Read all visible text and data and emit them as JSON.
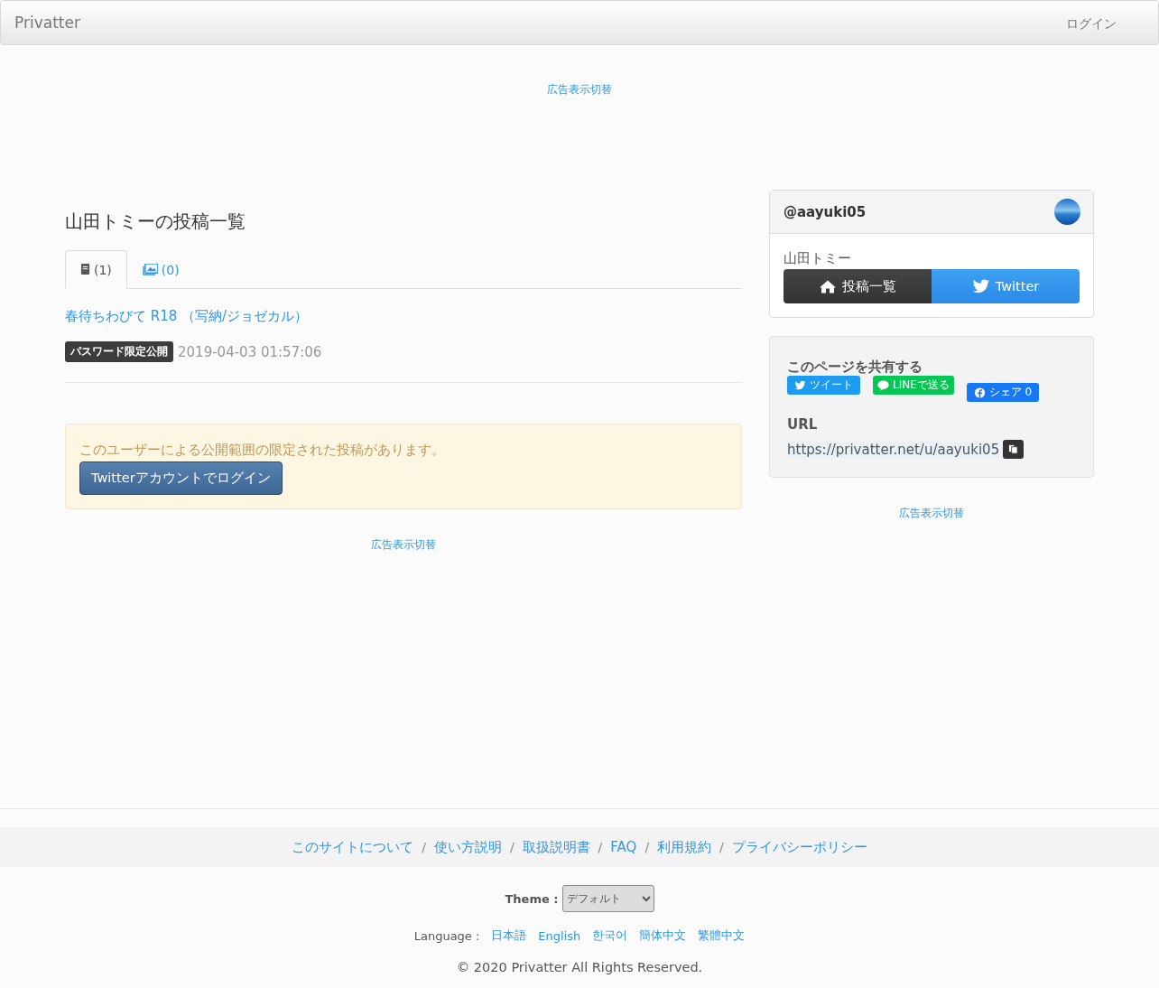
{
  "navbar": {
    "brand": "Privatter",
    "login": "ログイン"
  },
  "ad_toggle_top": "広告表示切替",
  "main": {
    "title": "山田トミーの投稿一覧",
    "tabs": [
      {
        "kind": "text",
        "label": "(1)",
        "selected": true
      },
      {
        "kind": "image",
        "label": "(0)",
        "selected": false
      }
    ],
    "posts": [
      {
        "title": "春待ちわびて R18 （写納/ジョゼカル）",
        "badge": "パスワード限定公開",
        "date": "2019-04-03 01:57:06"
      }
    ],
    "notice": {
      "message": "このユーザーによる公開範囲の限定された投稿があります。",
      "button": "Twitterアカウントでログイン"
    },
    "ad_toggle": "広告表示切替"
  },
  "profile": {
    "handle": "@aayuki05",
    "name": "山田トミー",
    "buttons": [
      {
        "kind": "home",
        "label": "投稿一覧"
      },
      {
        "kind": "twitter",
        "label": "Twitter"
      }
    ]
  },
  "share": {
    "title": "このページを共有する",
    "buttons": [
      {
        "kind": "tweet",
        "label": "ツイート"
      },
      {
        "kind": "line",
        "label": "LINEで送る"
      },
      {
        "kind": "facebook",
        "label": "シェア 0"
      }
    ],
    "url_label": "URL",
    "url": "https://privatter.net/u/aayuki05"
  },
  "ad_toggle_side": "広告表示切替",
  "footer": {
    "links": [
      "このサイトについて",
      "使い方説明",
      "取扱説明書",
      "FAQ",
      "利用規約",
      "プライバシーポリシー"
    ],
    "separator": "/",
    "theme_label": "Theme :",
    "theme_value": "デフォルト",
    "language_label": "Language :",
    "languages": [
      "日本語",
      "English",
      "한국어",
      "簡体中文",
      "繁體中文"
    ],
    "copyright": "© 2020 Privatter All Rights Reserved."
  }
}
